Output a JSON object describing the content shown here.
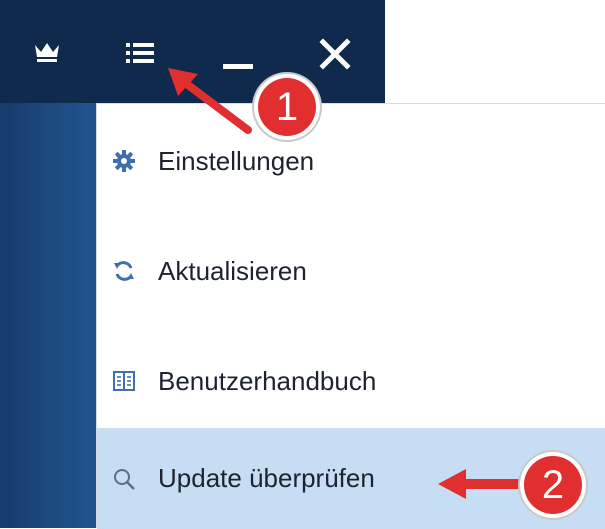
{
  "colors": {
    "titlebar_bg": "#0f2a4c",
    "menu_highlight": "#c6ddf3",
    "annotation_red": "#e12e2e",
    "icon_blue": "#3e6fae"
  },
  "titlebar": {
    "icons": [
      "crown-icon",
      "hamburger-menu-icon",
      "minimize-icon",
      "close-icon"
    ]
  },
  "menu": {
    "items": [
      {
        "label": "Einstellungen",
        "icon": "gear-icon"
      },
      {
        "label": "Aktualisieren",
        "icon": "refresh-icon"
      },
      {
        "label": "Benutzerhandbuch",
        "icon": "book-icon"
      },
      {
        "label": "Update überprüfen",
        "icon": "search-icon",
        "highlighted": true
      }
    ]
  },
  "annotations": {
    "step1": "1",
    "step2": "2"
  }
}
